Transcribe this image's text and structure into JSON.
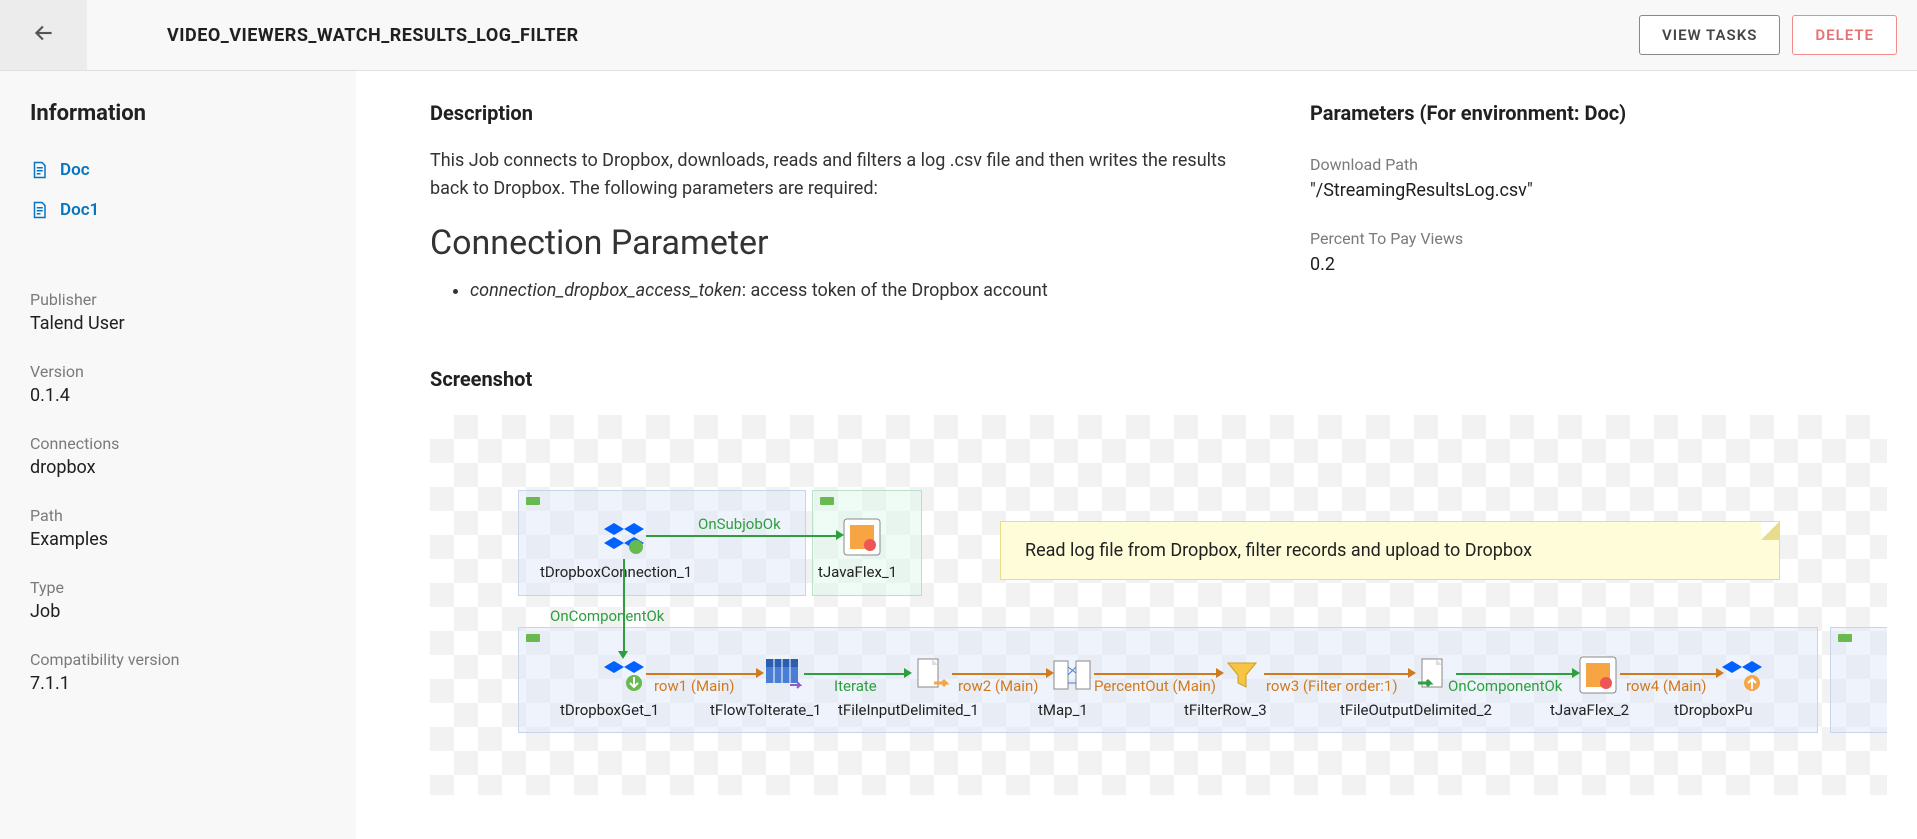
{
  "header": {
    "title": "VIDEO_VIEWERS_WATCH_RESULTS_LOG_FILTER",
    "view_tasks": "VIEW TASKS",
    "delete": "DELETE"
  },
  "sidebar": {
    "heading": "Information",
    "nav": [
      {
        "label": "Doc"
      },
      {
        "label": "Doc1"
      }
    ],
    "info": [
      {
        "label": "Publisher",
        "value": "Talend User"
      },
      {
        "label": "Version",
        "value": "0.1.4"
      },
      {
        "label": "Connections",
        "value": "dropbox"
      },
      {
        "label": "Path",
        "value": "Examples"
      },
      {
        "label": "Type",
        "value": "Job"
      },
      {
        "label": "Compatibility version",
        "value": "7.1.1"
      }
    ]
  },
  "description": {
    "heading": "Description",
    "text": "This Job connects to Dropbox, downloads, reads and filters a log .csv file and then writes the results back to Dropbox. The following parameters are required:",
    "section_title": "Connection Parameter",
    "bullet_em": "connection_dropbox_access_token",
    "bullet_rest": ": access token of the Dropbox account"
  },
  "parameters": {
    "heading": "Parameters (For environment: Doc)",
    "items": [
      {
        "label": "Download Path",
        "value": "\"/StreamingResultsLog.csv\""
      },
      {
        "label": "Percent To Pay Views",
        "value": "0.2"
      }
    ]
  },
  "screenshot": {
    "heading": "Screenshot",
    "note": "Read log file from Dropbox, filter records and upload to Dropbox",
    "components": {
      "c1": "tDropboxConnection_1",
      "c2": "tJavaFlex_1",
      "c3": "tDropboxGet_1",
      "c4": "tFlowToIterate_1",
      "c5": "tFileInputDelimited_1",
      "c6": "tMap_1",
      "c7": "tFilterRow_3",
      "c8": "tFileOutputDelimited_2",
      "c9": "tJavaFlex_2",
      "c10": "tDropboxPu"
    },
    "links": {
      "l1": "OnSubjobOk",
      "l2": "OnComponentOk",
      "l3": "row1 (Main)",
      "l4": "Iterate",
      "l5": "row2 (Main)",
      "l6": "PercentOut (Main)",
      "l7": "row3 (Filter order:1)",
      "l8": "OnComponentOk",
      "l9": "row4 (Main)"
    }
  }
}
